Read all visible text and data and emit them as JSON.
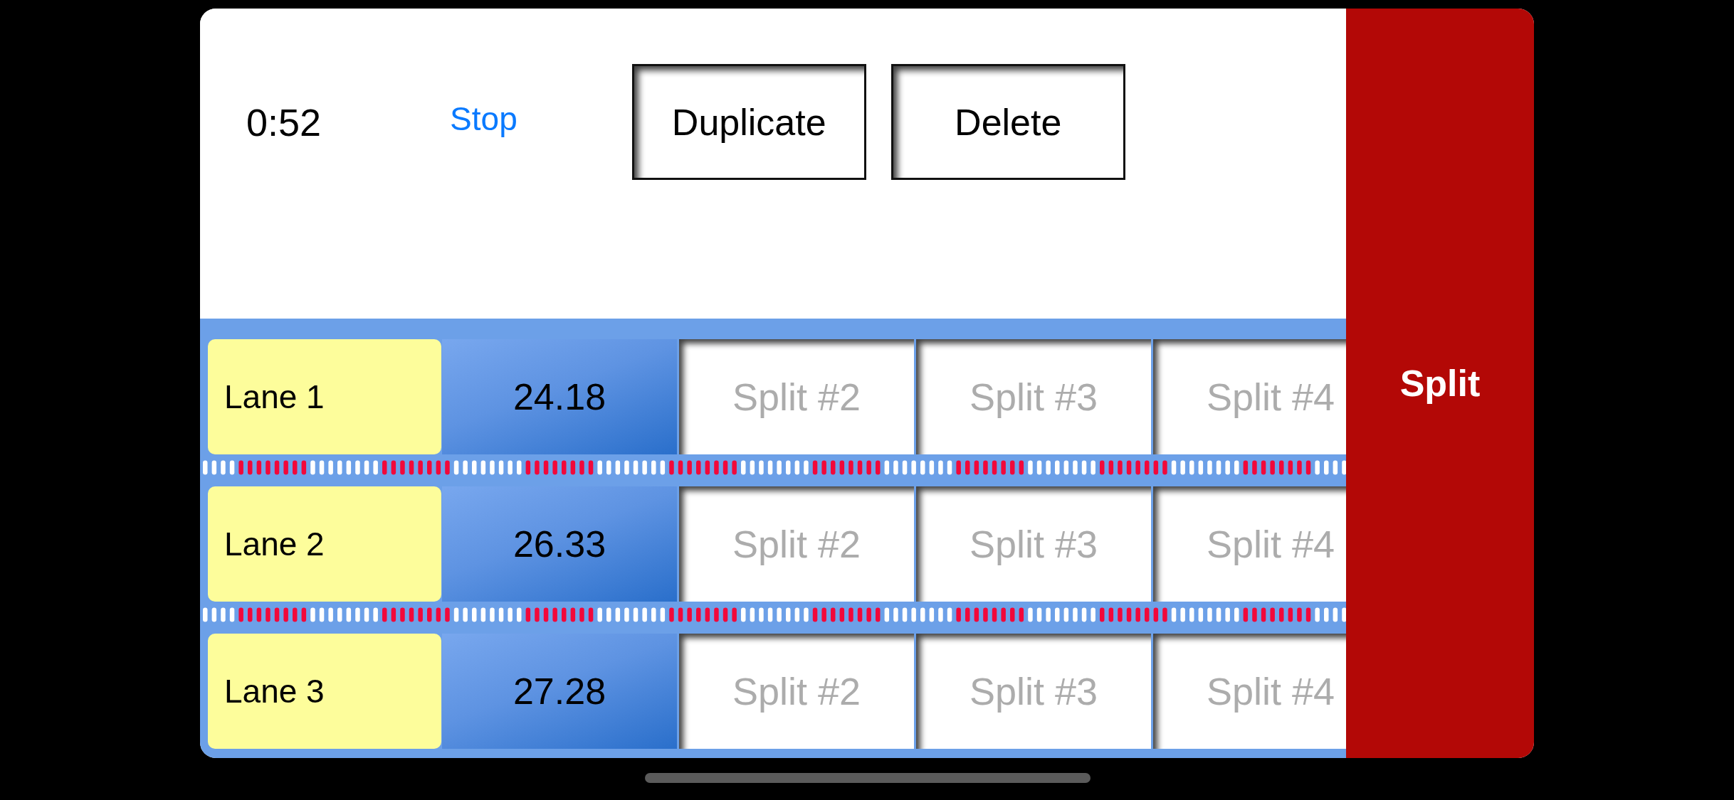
{
  "toolbar": {
    "timer": "0:52",
    "stop_link": "Stop",
    "buttons": [
      "Duplicate",
      "Delete"
    ]
  },
  "lanes": [
    {
      "name": "Lane 1",
      "time": "24.18",
      "splits": [
        {
          "placeholder": "Split #2"
        },
        {
          "placeholder": "Split #3"
        },
        {
          "placeholder": "Split #4"
        }
      ]
    },
    {
      "name": "Lane 2",
      "time": "26.33",
      "splits": [
        {
          "placeholder": "Split #2"
        },
        {
          "placeholder": "Split #3"
        },
        {
          "placeholder": "Split #4"
        }
      ]
    },
    {
      "name": "Lane 3",
      "time": "27.28",
      "splits": [
        {
          "placeholder": "Split #2"
        },
        {
          "placeholder": "Split #3"
        },
        {
          "placeholder": "Split #4"
        }
      ]
    }
  ],
  "split_button": "Split"
}
